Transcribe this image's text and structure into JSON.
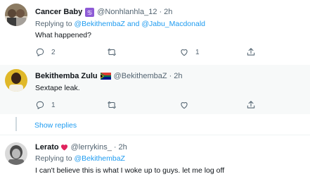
{
  "tweets": [
    {
      "name": "Cancer Baby",
      "badge": "♋",
      "handle": "@Nonhlanhla_12",
      "time": "2h",
      "replying_prefix": "Replying to",
      "replying_user1": "@BekithembaZ",
      "replying_and": "and",
      "replying_user2": "@Jabu_Macdonald",
      "text": "What happened?",
      "replies": "2",
      "retweets": "",
      "likes": "1"
    },
    {
      "name": "Bekithemba Zulu",
      "flag": "south-africa-flag-icon",
      "handle": "@BekithembaZ",
      "time": "2h",
      "text": "Sextape leak.",
      "replies": "1",
      "retweets": "",
      "likes": ""
    },
    {
      "name": "Lerato",
      "heart": "❤",
      "handle": "@lerrykins_",
      "time": "2h",
      "replying_prefix": "Replying to",
      "replying_user1": "@BekithembaZ",
      "text": "I can't believe this is what I woke up to guys. let me log off"
    }
  ],
  "show_replies": "Show replies",
  "colors": {
    "accent": "#1d9bf0",
    "secondary_text": "#536471",
    "primary_text": "#0f1419",
    "highlight_bg": "#f7f9f9",
    "thread_line": "#cfd9de"
  }
}
